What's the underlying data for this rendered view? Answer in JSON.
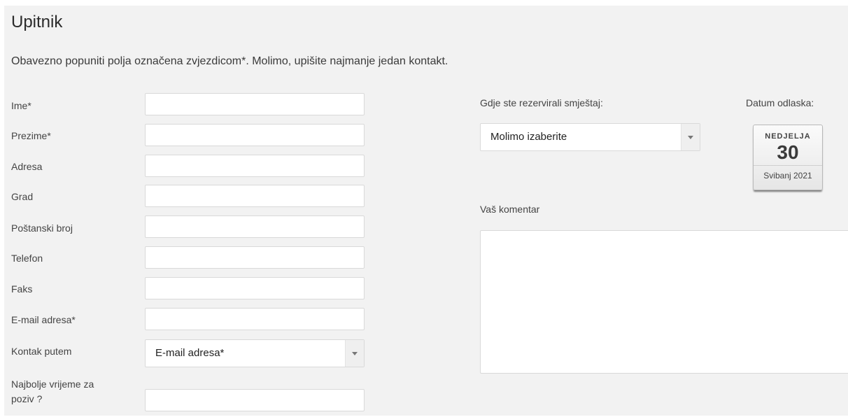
{
  "form": {
    "title": "Upitnik",
    "intro": "Obavezno popuniti polja označena zvjezdicom*. Molimo, upišite najmanje jedan kontakt.",
    "fields": [
      {
        "label": "Ime*",
        "value": ""
      },
      {
        "label": "Prezime*",
        "value": ""
      },
      {
        "label": "Adresa",
        "value": ""
      },
      {
        "label": "Grad",
        "value": ""
      },
      {
        "label": "Poštanski broj",
        "value": ""
      },
      {
        "label": "Telefon",
        "value": ""
      },
      {
        "label": "Faks",
        "value": ""
      },
      {
        "label": "E-mail adresa*",
        "value": ""
      }
    ],
    "contact_by": {
      "label": "Kontak putem",
      "selected": "E-mail adresa*"
    },
    "best_time": {
      "label_line1": "Najbolje vrijeme za",
      "label_line2": "poziv ?",
      "value": ""
    }
  },
  "booking": {
    "label": "Gdje ste rezervirali smještaj:",
    "selected": "Molimo izaberite"
  },
  "departure": {
    "label": "Datum odlaska:",
    "weekday": "NEDJELJA",
    "day": "30",
    "month_year": "Svibanj 2021"
  },
  "comment": {
    "label": "Vaš komentar",
    "value": ""
  }
}
